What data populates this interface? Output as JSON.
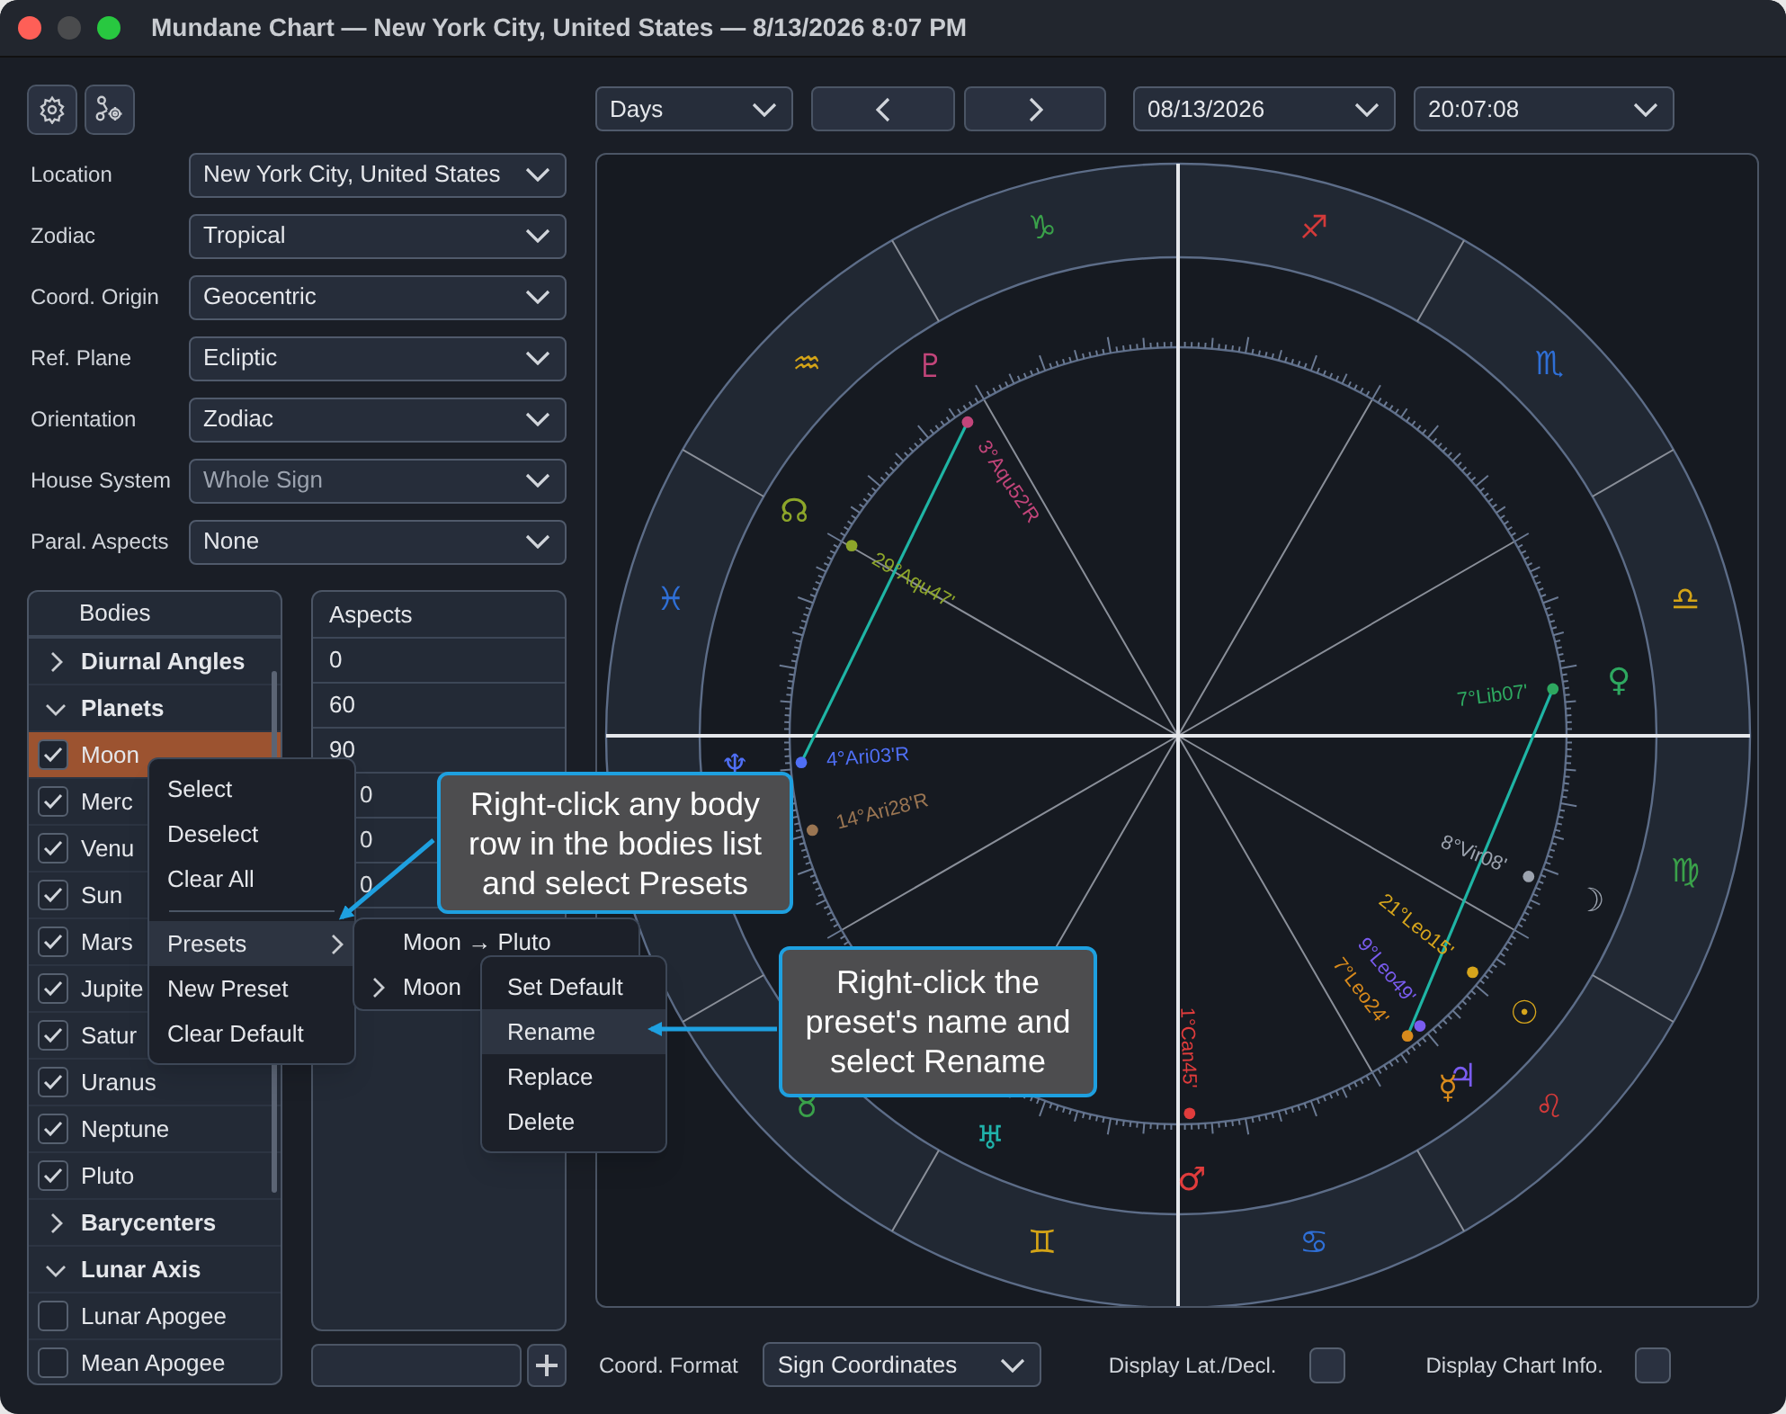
{
  "window": {
    "title": "Mundane Chart — New York City, United States — 8/13/2026 8:07 PM"
  },
  "settings": [
    {
      "label": "Location",
      "value": "New York City, United States",
      "disabled": false
    },
    {
      "label": "Zodiac",
      "value": "Tropical",
      "disabled": false
    },
    {
      "label": "Coord. Origin",
      "value": "Geocentric",
      "disabled": false
    },
    {
      "label": "Ref. Plane",
      "value": "Ecliptic",
      "disabled": false
    },
    {
      "label": "Orientation",
      "value": "Zodiac",
      "disabled": false
    },
    {
      "label": "House System",
      "value": "Whole Sign",
      "disabled": true
    },
    {
      "label": "Paral. Aspects",
      "value": "None",
      "disabled": false
    }
  ],
  "bodies": {
    "title": "Bodies",
    "items": [
      {
        "label": "Diurnal Angles",
        "expanded": false
      },
      {
        "label": "Planets",
        "expanded": true,
        "children": [
          {
            "label": "Moon",
            "checked": true,
            "selected": true
          },
          {
            "label": "Merc",
            "checked": true,
            "selected": false
          },
          {
            "label": "Venu",
            "checked": true,
            "selected": false
          },
          {
            "label": "Sun",
            "checked": true,
            "selected": false
          },
          {
            "label": "Mars",
            "checked": true,
            "selected": false
          },
          {
            "label": "Jupite",
            "checked": true,
            "selected": false
          },
          {
            "label": "Satur",
            "checked": true,
            "selected": false
          },
          {
            "label": "Uranus",
            "checked": true,
            "selected": false
          },
          {
            "label": "Neptune",
            "checked": true,
            "selected": false
          },
          {
            "label": "Pluto",
            "checked": true,
            "selected": false
          }
        ]
      },
      {
        "label": "Barycenters",
        "expanded": false
      },
      {
        "label": "Lunar Axis",
        "expanded": true,
        "children": [
          {
            "label": "Lunar Apogee",
            "checked": false,
            "selected": false
          },
          {
            "label": "Mean Apogee",
            "checked": false,
            "selected": false
          }
        ]
      }
    ]
  },
  "aspects": {
    "title": "Aspects",
    "rows": [
      {
        "value": "0"
      },
      {
        "value": "60"
      },
      {
        "value": "90"
      },
      {
        "value": "0",
        "clipped": true
      },
      {
        "value": "0",
        "clipped": true
      },
      {
        "value": "0",
        "clipped": true
      }
    ]
  },
  "navigation": {
    "step": "Days",
    "date": "08/13/2026",
    "time": "20:07:08"
  },
  "chart": {
    "signs": [
      {
        "glyph": "♉",
        "color": "#3aa14a"
      },
      {
        "glyph": "♊",
        "color": "#d4a417"
      },
      {
        "glyph": "♋",
        "color": "#2f6fd6"
      },
      {
        "glyph": "♌",
        "color": "#d23a3a"
      },
      {
        "glyph": "♍",
        "color": "#3aa14a"
      },
      {
        "glyph": "♎",
        "color": "#d4a417"
      },
      {
        "glyph": "♏",
        "color": "#2f6fd6"
      },
      {
        "glyph": "♐",
        "color": "#d23a3a"
      },
      {
        "glyph": "♑",
        "color": "#3aa14a"
      },
      {
        "glyph": "♒",
        "color": "#d4a417"
      },
      {
        "glyph": "♓",
        "color": "#2f6fd6"
      }
    ],
    "bodies": [
      {
        "glyph": "♇",
        "label": "3°Aqu52'R",
        "color": "#c2457a"
      },
      {
        "glyph": "☊",
        "label": "29°Aqu47'",
        "color": "#8da62a"
      },
      {
        "glyph": "♆",
        "label": "4°Ari03'R",
        "color": "#4f6ff5"
      },
      {
        "label": "14°Ari28'R",
        "color": "#9a7552"
      },
      {
        "glyph": "♀",
        "label": "7°Lib07'",
        "color": "#2ea860"
      },
      {
        "glyph": "☽",
        "label": "8°Vir08'",
        "color": "#9ca3af"
      },
      {
        "glyph": "☉",
        "label": "21°Leo15'",
        "color": "#d6a51c"
      },
      {
        "glyph": "♃",
        "label": "9°Leo49'",
        "color": "#7a5cf0"
      },
      {
        "glyph": "☿",
        "label": "7°Leo24'",
        "color": "#d88a1c"
      },
      {
        "glyph": "♂",
        "label": "1°Can45'",
        "color": "#e03c3c"
      },
      {
        "glyph": "♅",
        "color": "#20b2aa"
      }
    ]
  },
  "bottom": {
    "format_label": "Coord. Format",
    "format_value": "Sign Coordinates",
    "options": [
      {
        "label": "Display Lat./Decl.",
        "checked": false
      },
      {
        "label": "Display Chart Info.",
        "checked": false
      }
    ]
  },
  "context_menu": {
    "items": [
      {
        "kind": "item",
        "label": "Select",
        "selected": false
      },
      {
        "kind": "item",
        "label": "Deselect",
        "selected": false
      },
      {
        "kind": "item",
        "label": "Clear All",
        "selected": false
      },
      {
        "kind": "separator"
      },
      {
        "kind": "submenu",
        "label": "Presets",
        "selected": true
      },
      {
        "kind": "item",
        "label": "New Preset",
        "selected": false
      },
      {
        "kind": "item",
        "label": "Clear Default",
        "selected": false
      }
    ]
  },
  "preset_menu": {
    "items": [
      {
        "label": "Moon → Pluto",
        "has_submenu": false
      },
      {
        "label": "Moon",
        "has_submenu": true
      }
    ]
  },
  "preset_actions": {
    "items": [
      {
        "label": "Set Default",
        "selected": false
      },
      {
        "label": "Rename",
        "selected": true
      },
      {
        "label": "Replace",
        "selected": false
      },
      {
        "label": "Delete",
        "selected": false
      }
    ]
  },
  "callouts": [
    {
      "text": "Right-click any body row in the bodies list and select Presets"
    },
    {
      "text": "Right-click the preset's name and select Rename"
    }
  ]
}
